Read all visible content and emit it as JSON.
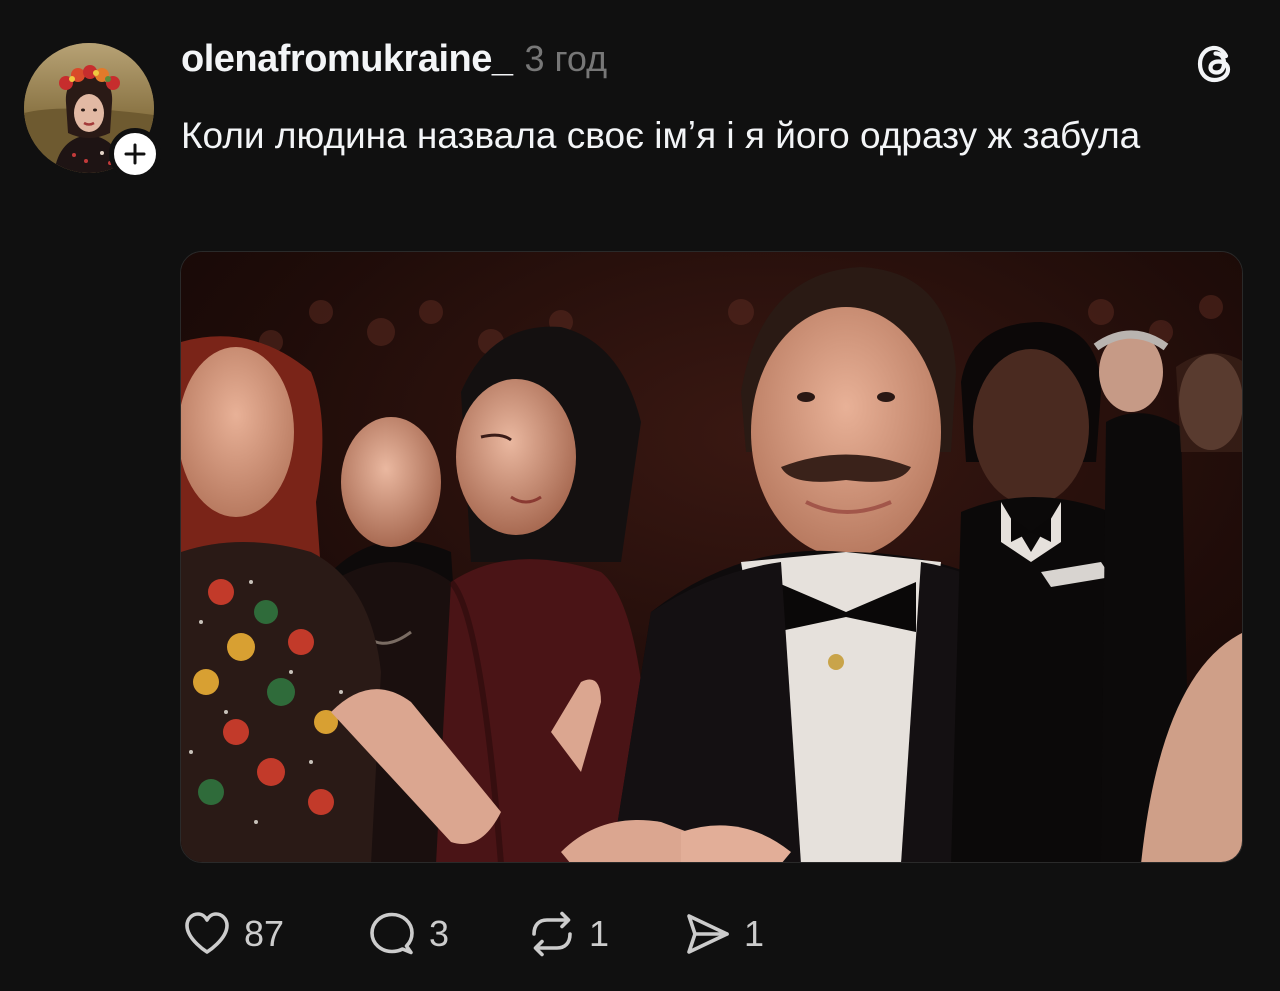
{
  "post": {
    "username": "olenafromukraine_",
    "time": "3 год",
    "text": "Коли людина назвала своє імʼя і я його одразу ж забула",
    "avatar_icon": "user-avatar-photo",
    "follow_icon": "plus-icon",
    "brand_icon": "threads-logo-icon",
    "media_icon": "video-still-image"
  },
  "actions": {
    "like": {
      "icon": "heart-icon",
      "count": "87"
    },
    "reply": {
      "icon": "comment-bubble-icon",
      "count": "3"
    },
    "repost": {
      "icon": "repost-icon",
      "count": "1"
    },
    "share": {
      "icon": "send-icon",
      "count": "1"
    }
  },
  "colors": {
    "background": "#101010",
    "text": "#f3f5f7",
    "muted": "#777777",
    "count": "#cccccc"
  }
}
